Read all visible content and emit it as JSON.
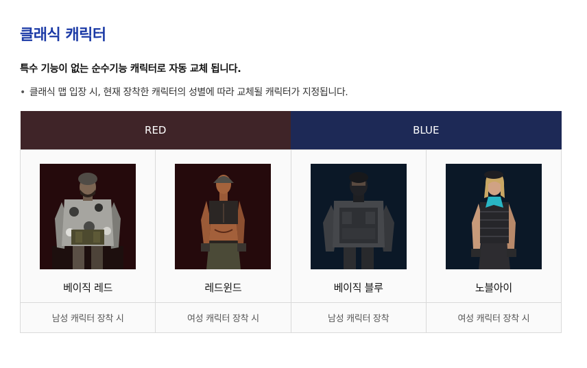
{
  "heading": "클래식 캐릭터",
  "subtitle": "특수 기능이 없는 순수기능 캐릭터로 자동 교체 됩니다.",
  "note": "클래식 맵 입장 시, 현재 장착한 캐릭터의 성별에 따라 교체될 캐릭터가 지정됩니다.",
  "teams": {
    "red": "RED",
    "blue": "BLUE",
    "red_color": "#3f2428",
    "blue_color": "#1d2956"
  },
  "characters": [
    {
      "name": "베이직 레드",
      "condition": "남성 캐릭터 장착 시",
      "team": "RED",
      "bg_color": "#250a0c"
    },
    {
      "name": "레드윈드",
      "condition": "여성 캐릭터 장착 시",
      "team": "RED",
      "bg_color": "#250a0c"
    },
    {
      "name": "베이직 블루",
      "condition": "남성 캐릭터 장착",
      "team": "BLUE",
      "bg_color": "#0b1827"
    },
    {
      "name": "노블아이",
      "condition": "여성 캐릭터 장착 시",
      "team": "BLUE",
      "bg_color": "#0b1827"
    }
  ]
}
